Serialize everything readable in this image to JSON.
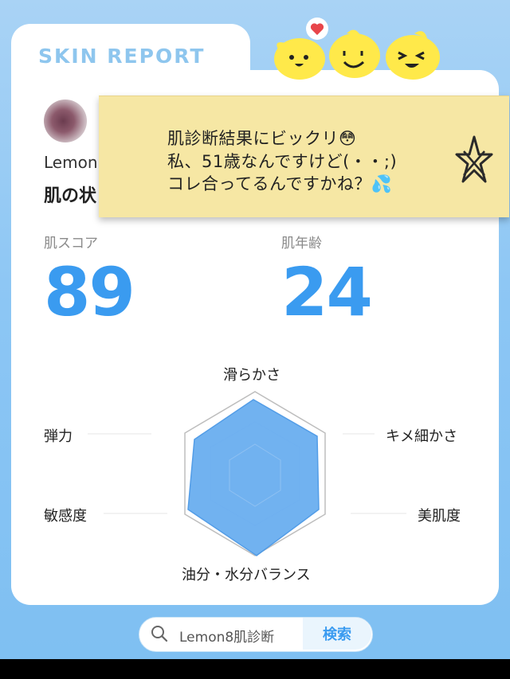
{
  "header": {
    "title": "SKIN REPORT"
  },
  "profile": {
    "username": "Lemon",
    "status_label": "肌の状"
  },
  "note": {
    "line1": "肌診断結果にビックリ😳",
    "line2": "私、51歳なんですけど(・・;)",
    "line3": "コレ合ってるんですかね？💦"
  },
  "scores": {
    "skin_score_label": "肌スコア",
    "skin_score_value": "89",
    "skin_age_label": "肌年齢",
    "skin_age_value": "24"
  },
  "radar": {
    "labels": {
      "top": "滑らかさ",
      "right_upper": "キメ細かさ",
      "right_lower": "美肌度",
      "bottom": "油分・水分バランス",
      "left_lower": "敏感度",
      "left_upper": "弾力"
    }
  },
  "search": {
    "query": "Lemon8肌診断",
    "button_label": "検索"
  },
  "colors": {
    "accent": "#3a9bf0",
    "title_blue": "#8ec6ee",
    "note_yellow": "#f6e7a4",
    "radar_fill": "#6aaef0",
    "mascot_yellow": "#ffe94a"
  },
  "icons": {
    "search": "search-icon",
    "heart": "heart-icon",
    "star": "star-doodle-icon"
  }
}
